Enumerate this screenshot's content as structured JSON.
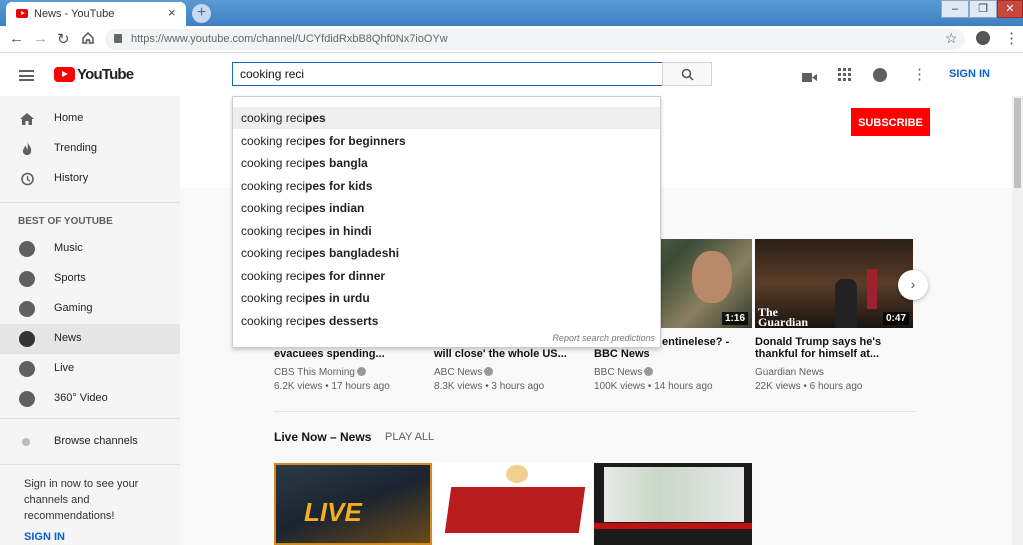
{
  "browser": {
    "tab_title": "News - YouTube",
    "tab_close": "×",
    "new_tab": "+",
    "url": "https://www.youtube.com/channel/UCYfdidRxbB8Qhf0Nx7ioOYw",
    "win_min": "‒",
    "win_max": "❐",
    "win_close": "✕"
  },
  "header": {
    "logo_text": "YouTube",
    "search_value": "cooking reci",
    "sign_in": "SIGN IN"
  },
  "search_suggestions": {
    "typed": "cooking reci",
    "items": [
      {
        "rest": "pes"
      },
      {
        "rest": "pes for beginners"
      },
      {
        "rest": "pes bangla"
      },
      {
        "rest": "pes for kids"
      },
      {
        "rest": "pes indian"
      },
      {
        "rest": "pes in hindi"
      },
      {
        "rest": "pes bangladeshi"
      },
      {
        "rest": "pes for dinner"
      },
      {
        "rest": "pes in urdu"
      },
      {
        "rest": "pes desserts"
      }
    ],
    "report": "Report search predictions"
  },
  "sidebar": {
    "items": [
      {
        "label": "Home",
        "icon": "home-icon"
      },
      {
        "label": "Trending",
        "icon": "flame-icon"
      },
      {
        "label": "History",
        "icon": "history-icon"
      }
    ],
    "best_heading": "BEST OF YOUTUBE",
    "best_items": [
      {
        "label": "Music",
        "icon": "music-icon"
      },
      {
        "label": "Sports",
        "icon": "sports-icon"
      },
      {
        "label": "Gaming",
        "icon": "gaming-icon"
      },
      {
        "label": "News",
        "icon": "news-icon",
        "active": true
      },
      {
        "label": "Live",
        "icon": "live-icon"
      },
      {
        "label": "360° Video",
        "icon": "360-video-icon"
      }
    ],
    "browse": "Browse channels",
    "signin_msg": "Sign in now to see your channels and recommendations!",
    "signin": "SIGN IN"
  },
  "channel": {
    "subscribe": "SUBSCRIBE"
  },
  "videos": [
    {
      "title": "evacuees spending...",
      "channel": "CBS This Morning",
      "meta": "6.2K views • 17 hours ago"
    },
    {
      "title": "will close' the whole US...",
      "channel": "ABC News",
      "meta": "8.3K views • 3 hours ago"
    },
    {
      "title_l1": "entinelese? -",
      "title": "BBC News",
      "channel": "BBC News",
      "meta": "100K views • 14 hours ago",
      "duration": "1:16"
    },
    {
      "title_l1": "Donald Trump says he's",
      "title": "thankful for himself at...",
      "channel": "Guardian News",
      "meta": "22K views • 6 hours ago",
      "duration": "0:47"
    }
  ],
  "live_section": {
    "heading": "Live Now – News",
    "play_all": "PLAY ALL"
  },
  "colors": {
    "accent_red": "#ff0000",
    "link_blue": "#065fd4"
  }
}
